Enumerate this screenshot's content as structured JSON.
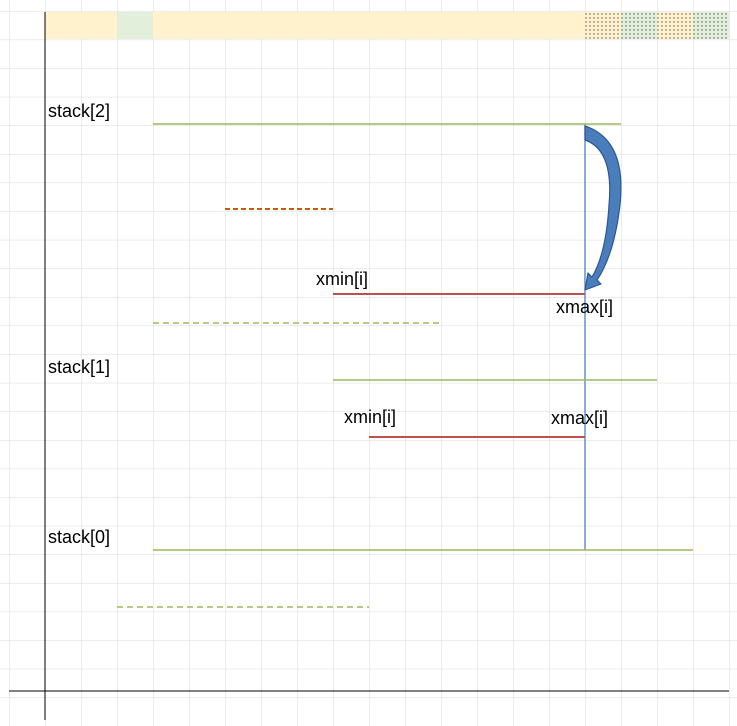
{
  "labels": {
    "stack_2": "stack[2]",
    "stack_1": "stack[1]",
    "stack_0": "stack[0]",
    "upper_xmin": "xmin[i]",
    "upper_xmax": "xmax[i]",
    "lower_xmin": "xmin[i]",
    "lower_xmax": "xmax[i]"
  },
  "colors": {
    "grid": "#d9d9d9",
    "axis": "#000000",
    "stack_line": "#9bbb59",
    "interval_line": "#c0504d",
    "interval_dash": "#c55a11",
    "guide_line": "#4f81bd",
    "arrow_fill": "#4a7ebb",
    "arrow_stroke": "#2f5597",
    "band_yellow": "#fff2cc",
    "band_green": "#e2efda"
  },
  "icons": {
    "arrow": "curved-arrow-down-icon"
  }
}
